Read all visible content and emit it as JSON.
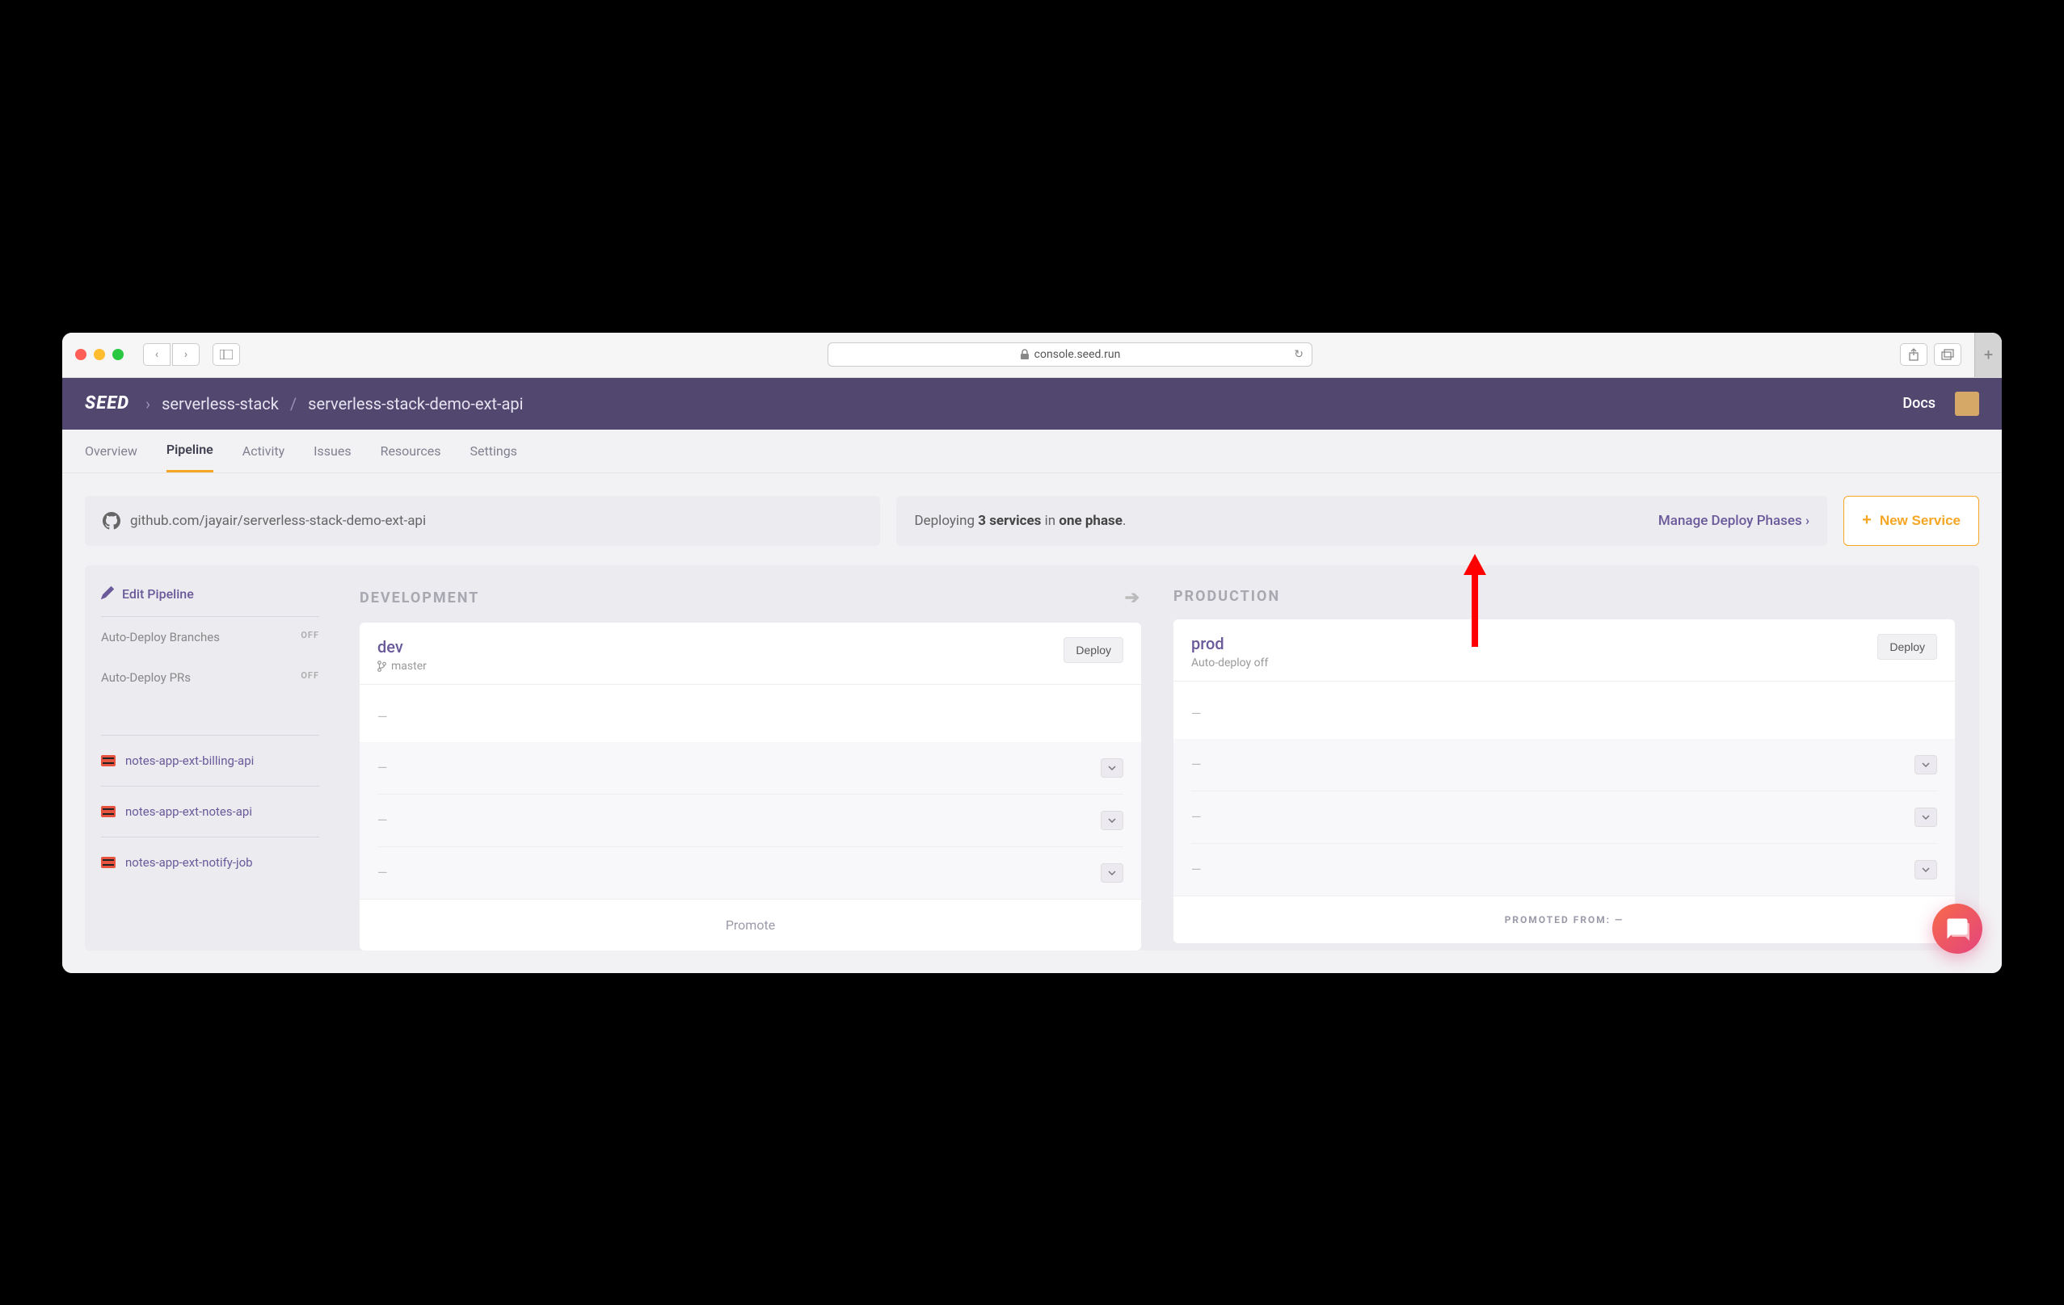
{
  "browser": {
    "url_host": "console.seed.run"
  },
  "header": {
    "logo": "SEED",
    "org": "serverless-stack",
    "project": "serverless-stack-demo-ext-api",
    "docs": "Docs"
  },
  "tabs": {
    "overview": "Overview",
    "pipeline": "Pipeline",
    "activity": "Activity",
    "issues": "Issues",
    "resources": "Resources",
    "settings": "Settings"
  },
  "info": {
    "repo": "github.com/jayair/serverless-stack-demo-ext-api",
    "deploying_prefix": "Deploying ",
    "services_count": "3 services",
    "in": " in ",
    "phase": "one phase",
    "period": ".",
    "manage": "Manage Deploy Phases ›",
    "new_service": "New Service"
  },
  "sidebar": {
    "edit": "Edit Pipeline",
    "auto_branches": "Auto-Deploy Branches",
    "auto_prs": "Auto-Deploy PRs",
    "off": "OFF",
    "services": [
      "notes-app-ext-billing-api",
      "notes-app-ext-notes-api",
      "notes-app-ext-notify-job"
    ]
  },
  "stages": {
    "dev_label": "DEVELOPMENT",
    "prod_label": "PRODUCTION",
    "dev": {
      "name": "dev",
      "branch": "master",
      "deploy": "Deploy",
      "footer": "Promote"
    },
    "prod": {
      "name": "prod",
      "sub": "Auto-deploy off",
      "deploy": "Deploy",
      "footer": "PROMOTED FROM: —"
    }
  }
}
